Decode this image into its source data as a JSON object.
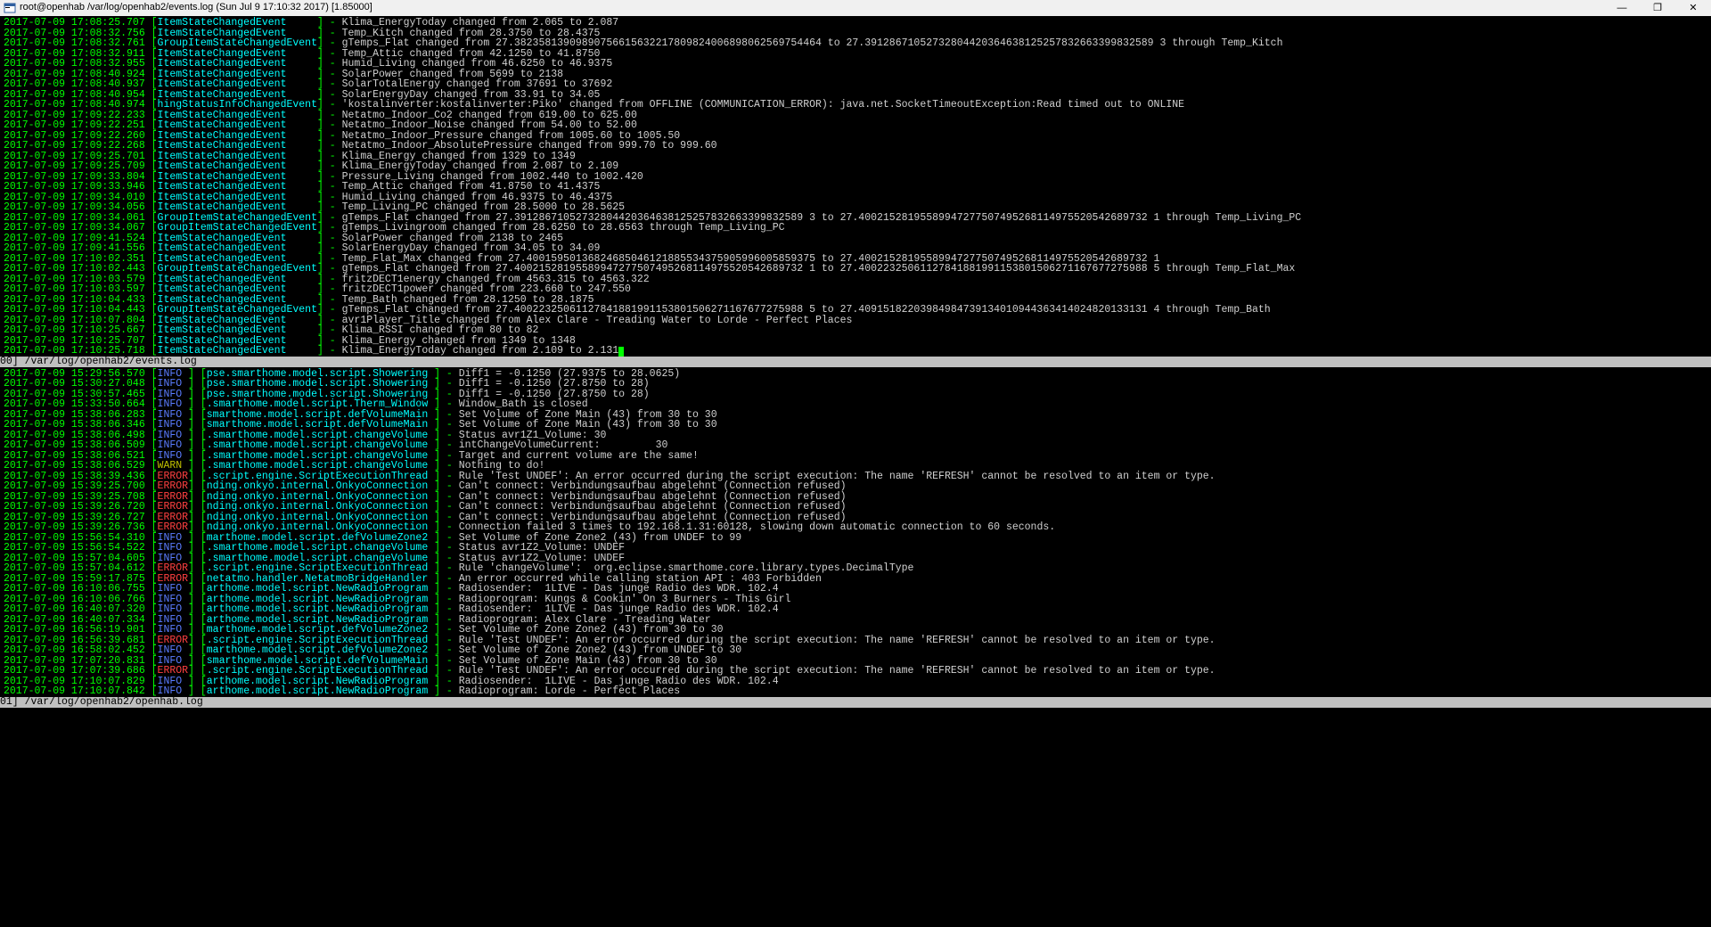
{
  "window": {
    "title": "root@openhab /var/log/openhab2/events.log (Sun Jul  9 17:10:32 2017) [1.85000]"
  },
  "pane0": {
    "status": "00] /var/log/openhab2/events.log",
    "lines": [
      {
        "ts": "2017-07-09 17:08:25.707",
        "ev": "ItemStateChangedEvent     ",
        "msg": "Klima_EnergyToday changed from 2.065 to 2.087"
      },
      {
        "ts": "2017-07-09 17:08:32.756",
        "ev": "ItemStateChangedEvent     ",
        "msg": "Temp_Kitch changed from 28.3750 to 28.4375"
      },
      {
        "ts": "2017-07-09 17:08:32.761",
        "ev": "GroupItemStateChangedEvent",
        "msg": "gTemps_Flat changed from 27.38235813909890756615632217809824006898062569754464 to 27.39128671052732804420364638125257832663399832589 3 through Temp_Kitch"
      },
      {
        "ts": "2017-07-09 17:08:32.911",
        "ev": "ItemStateChangedEvent     ",
        "msg": "Temp_Attic changed from 42.1250 to 41.8750"
      },
      {
        "ts": "2017-07-09 17:08:32.955",
        "ev": "ItemStateChangedEvent     ",
        "msg": "Humid_Living changed from 46.6250 to 46.9375"
      },
      {
        "ts": "2017-07-09 17:08:40.924",
        "ev": "ItemStateChangedEvent     ",
        "msg": "SolarPower changed from 5699 to 2138"
      },
      {
        "ts": "2017-07-09 17:08:40.937",
        "ev": "ItemStateChangedEvent     ",
        "msg": "SolarTotalEnergy changed from 37691 to 37692"
      },
      {
        "ts": "2017-07-09 17:08:40.954",
        "ev": "ItemStateChangedEvent     ",
        "msg": "SolarEnergyDay changed from 33.91 to 34.05"
      },
      {
        "ts": "2017-07-09 17:08:40.974",
        "ev": "hingStatusInfoChangedEvent",
        "msg": "'kostalinverter:kostalinverter:Piko' changed from OFFLINE (COMMUNICATION_ERROR): java.net.SocketTimeoutException:Read timed out to ONLINE"
      },
      {
        "ts": "2017-07-09 17:09:22.233",
        "ev": "ItemStateChangedEvent     ",
        "msg": "Netatmo_Indoor_Co2 changed from 619.00 to 625.00"
      },
      {
        "ts": "2017-07-09 17:09:22.251",
        "ev": "ItemStateChangedEvent     ",
        "msg": "Netatmo_Indoor_Noise changed from 54.00 to 52.00"
      },
      {
        "ts": "2017-07-09 17:09:22.260",
        "ev": "ItemStateChangedEvent     ",
        "msg": "Netatmo_Indoor_Pressure changed from 1005.60 to 1005.50"
      },
      {
        "ts": "2017-07-09 17:09:22.268",
        "ev": "ItemStateChangedEvent     ",
        "msg": "Netatmo_Indoor_AbsolutePressure changed from 999.70 to 999.60"
      },
      {
        "ts": "2017-07-09 17:09:25.701",
        "ev": "ItemStateChangedEvent     ",
        "msg": "Klima_Energy changed from 1329 to 1349"
      },
      {
        "ts": "2017-07-09 17:09:25.709",
        "ev": "ItemStateChangedEvent     ",
        "msg": "Klima_EnergyToday changed from 2.087 to 2.109"
      },
      {
        "ts": "2017-07-09 17:09:33.804",
        "ev": "ItemStateChangedEvent     ",
        "msg": "Pressure_Living changed from 1002.440 to 1002.420"
      },
      {
        "ts": "2017-07-09 17:09:33.946",
        "ev": "ItemStateChangedEvent     ",
        "msg": "Temp_Attic changed from 41.8750 to 41.4375"
      },
      {
        "ts": "2017-07-09 17:09:34.010",
        "ev": "ItemStateChangedEvent     ",
        "msg": "Humid_Living changed from 46.9375 to 46.4375"
      },
      {
        "ts": "2017-07-09 17:09:34.056",
        "ev": "ItemStateChangedEvent     ",
        "msg": "Temp_Living_PC changed from 28.5000 to 28.5625"
      },
      {
        "ts": "2017-07-09 17:09:34.061",
        "ev": "GroupItemStateChangedEvent",
        "msg": "gTemps_Flat changed from 27.39128671052732804420364638125257832663399832589 3 to 27.40021528195589947277507495268114975520542689732 1 through Temp_Living_PC"
      },
      {
        "ts": "2017-07-09 17:09:34.067",
        "ev": "GroupItemStateChangedEvent",
        "msg": "gTemps_Livingroom changed from 28.6250 to 28.6563 through Temp_Living_PC"
      },
      {
        "ts": "2017-07-09 17:09:41.524",
        "ev": "ItemStateChangedEvent     ",
        "msg": "SolarPower changed from 2138 to 2465"
      },
      {
        "ts": "2017-07-09 17:09:41.556",
        "ev": "ItemStateChangedEvent     ",
        "msg": "SolarEnergyDay changed from 34.05 to 34.09"
      },
      {
        "ts": "2017-07-09 17:10:02.351",
        "ev": "ItemStateChangedEvent     ",
        "msg": "Temp_Flat_Max changed from 27.40015950136824685046121885534375905996005859375 to 27.40021528195589947277507495268114975520542689732 1"
      },
      {
        "ts": "2017-07-09 17:10:02.443",
        "ev": "GroupItemStateChangedEvent",
        "msg": "gTemps_Flat changed from 27.40021528195589947277507495268114975520542689732 1 to 27.40022325061127841881991153801506271167677275988 5 through Temp_Flat_Max"
      },
      {
        "ts": "2017-07-09 17:10:03.579",
        "ev": "ItemStateChangedEvent     ",
        "msg": "fritzDECT1energy changed from 4563.315 to 4563.322"
      },
      {
        "ts": "2017-07-09 17:10:03.597",
        "ev": "ItemStateChangedEvent     ",
        "msg": "fritzDECT1power changed from 223.660 to 247.550"
      },
      {
        "ts": "2017-07-09 17:10:04.433",
        "ev": "ItemStateChangedEvent     ",
        "msg": "Temp_Bath changed from 28.1250 to 28.1875"
      },
      {
        "ts": "2017-07-09 17:10:04.443",
        "ev": "GroupItemStateChangedEvent",
        "msg": "gTemps_Flat changed from 27.40022325061127841881991153801506271167677275988 5 to 27.40915182203984984739134010944363414024820133131 4 through Temp_Bath"
      },
      {
        "ts": "2017-07-09 17:10:07.804",
        "ev": "ItemStateChangedEvent     ",
        "msg": "avr1Player_Title changed from Alex Clare - Treading Water to Lorde - Perfect Places"
      },
      {
        "ts": "2017-07-09 17:10:25.667",
        "ev": "ItemStateChangedEvent     ",
        "msg": "Klima_RSSI changed from 80 to 82"
      },
      {
        "ts": "2017-07-09 17:10:25.707",
        "ev": "ItemStateChangedEvent     ",
        "msg": "Klima_Energy changed from 1349 to 1348"
      },
      {
        "ts": "2017-07-09 17:10:25.718",
        "ev": "ItemStateChangedEvent     ",
        "msg": "Klima_EnergyToday changed from 2.109 to 2.131"
      }
    ]
  },
  "pane1": {
    "status": "01] /var/log/openhab2/openhab.log",
    "lines": [
      {
        "ts": "2017-07-09 15:29:56.570",
        "lvl": "INFO ",
        "src": "pse.smarthome.model.script.Showering ",
        "msg": "Diff1 = -0.1250 (27.9375 to 28.0625)"
      },
      {
        "ts": "2017-07-09 15:30:27.048",
        "lvl": "INFO ",
        "src": "pse.smarthome.model.script.Showering ",
        "msg": "Diff1 = -0.1250 (27.8750 to 28)"
      },
      {
        "ts": "2017-07-09 15:30:57.465",
        "lvl": "INFO ",
        "src": "pse.smarthome.model.script.Showering ",
        "msg": "Diff1 = -0.1250 (27.8750 to 28)"
      },
      {
        "ts": "2017-07-09 15:33:50.664",
        "lvl": "INFO ",
        "src": ".smarthome.model.script.Therm_Window ",
        "msg": "Window_Bath is closed"
      },
      {
        "ts": "2017-07-09 15:38:06.283",
        "lvl": "INFO ",
        "src": "smarthome.model.script.defVolumeMain ",
        "msg": "Set Volume of Zone Main (43) from 30 to 30"
      },
      {
        "ts": "2017-07-09 15:38:06.346",
        "lvl": "INFO ",
        "src": "smarthome.model.script.defVolumeMain ",
        "msg": "Set Volume of Zone Main (43) from 30 to 30"
      },
      {
        "ts": "2017-07-09 15:38:06.498",
        "lvl": "INFO ",
        "src": ".smarthome.model.script.changeVolume ",
        "msg": "Status avr1Z1_Volume: 30"
      },
      {
        "ts": "2017-07-09 15:38:06.509",
        "lvl": "INFO ",
        "src": ".smarthome.model.script.changeVolume ",
        "msg": "intChangeVolumeCurrent:         30"
      },
      {
        "ts": "2017-07-09 15:38:06.521",
        "lvl": "INFO ",
        "src": ".smarthome.model.script.changeVolume ",
        "msg": "Target and current volume are the same!"
      },
      {
        "ts": "2017-07-09 15:38:06.529",
        "lvl": "WARN ",
        "src": ".smarthome.model.script.changeVolume ",
        "msg": "Nothing to do!"
      },
      {
        "ts": "2017-07-09 15:38:39.436",
        "lvl": "ERROR",
        "src": ".script.engine.ScriptExecutionThread ",
        "msg": "Rule 'Test UNDEF': An error occurred during the script execution: The name 'REFRESH' cannot be resolved to an item or type."
      },
      {
        "ts": "2017-07-09 15:39:25.700",
        "lvl": "ERROR",
        "src": "nding.onkyo.internal.OnkyoConnection ",
        "msg": "Can't connect: Verbindungsaufbau abgelehnt (Connection refused)"
      },
      {
        "ts": "2017-07-09 15:39:25.708",
        "lvl": "ERROR",
        "src": "nding.onkyo.internal.OnkyoConnection ",
        "msg": "Can't connect: Verbindungsaufbau abgelehnt (Connection refused)"
      },
      {
        "ts": "2017-07-09 15:39:26.720",
        "lvl": "ERROR",
        "src": "nding.onkyo.internal.OnkyoConnection ",
        "msg": "Can't connect: Verbindungsaufbau abgelehnt (Connection refused)"
      },
      {
        "ts": "2017-07-09 15:39:26.727",
        "lvl": "ERROR",
        "src": "nding.onkyo.internal.OnkyoConnection ",
        "msg": "Can't connect: Verbindungsaufbau abgelehnt (Connection refused)"
      },
      {
        "ts": "2017-07-09 15:39:26.736",
        "lvl": "ERROR",
        "src": "nding.onkyo.internal.OnkyoConnection ",
        "msg": "Connection failed 3 times to 192.168.1.31:60128, slowing down automatic connection to 60 seconds."
      },
      {
        "ts": "2017-07-09 15:56:54.310",
        "lvl": "INFO ",
        "src": "marthome.model.script.defVolumeZone2 ",
        "msg": "Set Volume of Zone Zone2 (43) from UNDEF to 99"
      },
      {
        "ts": "2017-07-09 15:56:54.522",
        "lvl": "INFO ",
        "src": ".smarthome.model.script.changeVolume ",
        "msg": "Status avr1Z2_Volume: UNDEF"
      },
      {
        "ts": "2017-07-09 15:57:04.605",
        "lvl": "INFO ",
        "src": ".smarthome.model.script.changeVolume ",
        "msg": "Status avr1Z2_Volume: UNDEF"
      },
      {
        "ts": "2017-07-09 15:57:04.612",
        "lvl": "ERROR",
        "src": ".script.engine.ScriptExecutionThread ",
        "msg": "Rule 'changeVolume':  org.eclipse.smarthome.core.library.types.DecimalType"
      },
      {
        "ts": "2017-07-09 15:59:17.875",
        "lvl": "ERROR",
        "src": "netatmo.handler.NetatmoBridgeHandler ",
        "msg": "An error occurred while calling station API : 403 Forbidden"
      },
      {
        "ts": "2017-07-09 16:10:06.755",
        "lvl": "INFO ",
        "src": "arthome.model.script.NewRadioProgram ",
        "msg": "Radiosender:  1LIVE - Das junge Radio des WDR. 102.4"
      },
      {
        "ts": "2017-07-09 16:10:06.766",
        "lvl": "INFO ",
        "src": "arthome.model.script.NewRadioProgram ",
        "msg": "Radioprogram: Kungs & Cookin' On 3 Burners - This Girl"
      },
      {
        "ts": "2017-07-09 16:40:07.320",
        "lvl": "INFO ",
        "src": "arthome.model.script.NewRadioProgram ",
        "msg": "Radiosender:  1LIVE - Das junge Radio des WDR. 102.4"
      },
      {
        "ts": "2017-07-09 16:40:07.334",
        "lvl": "INFO ",
        "src": "arthome.model.script.NewRadioProgram ",
        "msg": "Radioprogram: Alex Clare - Treading Water"
      },
      {
        "ts": "2017-07-09 16:56:19.901",
        "lvl": "INFO ",
        "src": "marthome.model.script.defVolumeZone2 ",
        "msg": "Set Volume of Zone Zone2 (43) from 30 to 30"
      },
      {
        "ts": "2017-07-09 16:56:39.681",
        "lvl": "ERROR",
        "src": ".script.engine.ScriptExecutionThread ",
        "msg": "Rule 'Test UNDEF': An error occurred during the script execution: The name 'REFRESH' cannot be resolved to an item or type."
      },
      {
        "ts": "2017-07-09 16:58:02.452",
        "lvl": "INFO ",
        "src": "marthome.model.script.defVolumeZone2 ",
        "msg": "Set Volume of Zone Zone2 (43) from UNDEF to 30"
      },
      {
        "ts": "2017-07-09 17:07:20.831",
        "lvl": "INFO ",
        "src": "smarthome.model.script.defVolumeMain ",
        "msg": "Set Volume of Zone Main (43) from 30 to 30"
      },
      {
        "ts": "2017-07-09 17:07:39.686",
        "lvl": "ERROR",
        "src": ".script.engine.ScriptExecutionThread ",
        "msg": "Rule 'Test UNDEF': An error occurred during the script execution: The name 'REFRESH' cannot be resolved to an item or type."
      },
      {
        "ts": "2017-07-09 17:10:07.829",
        "lvl": "INFO ",
        "src": "arthome.model.script.NewRadioProgram ",
        "msg": "Radiosender:  1LIVE - Das junge Radio des WDR. 102.4"
      },
      {
        "ts": "2017-07-09 17:10:07.842",
        "lvl": "INFO ",
        "src": "arthome.model.script.NewRadioProgram ",
        "msg": "Radioprogram: Lorde - Perfect Places"
      }
    ]
  }
}
